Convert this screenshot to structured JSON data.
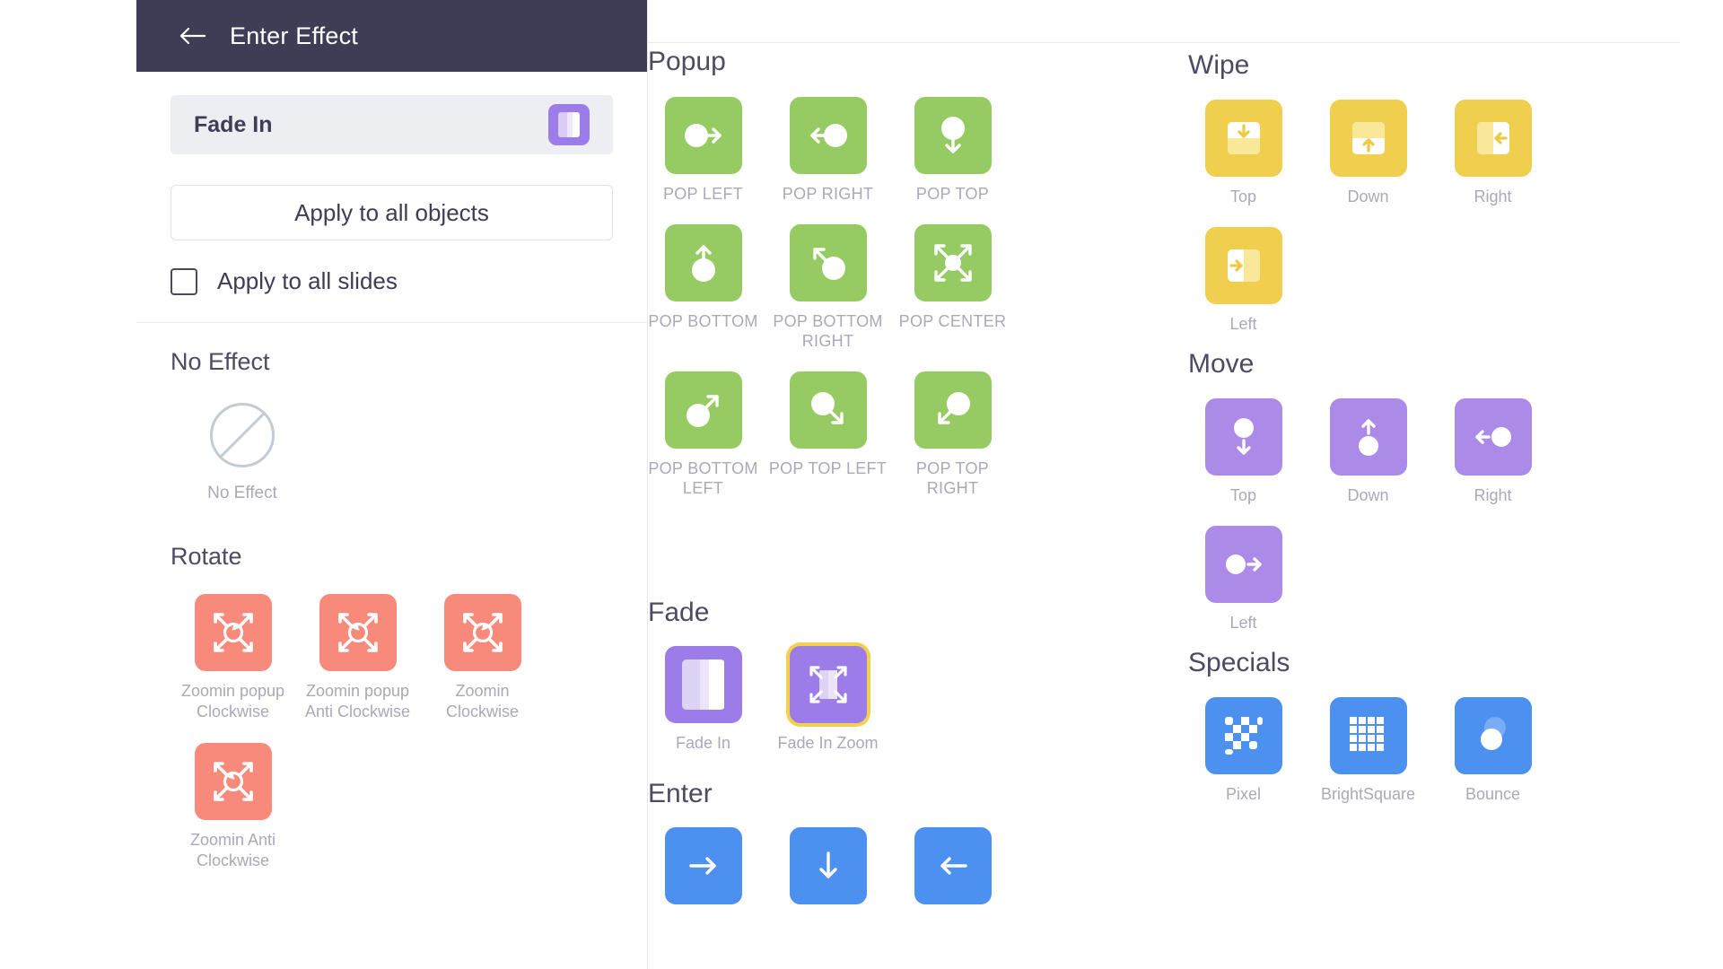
{
  "panel": {
    "back_icon": "back-arrow-icon",
    "title": "Enter Effect",
    "current_effect": "Fade In",
    "current_effect_icon": "fade-in-icon",
    "apply_to_all_objects": "Apply to all objects",
    "apply_to_all_slides": "Apply to all slides",
    "apply_to_all_slides_checked": false,
    "no_effect_section": "No Effect",
    "no_effect_label": "No Effect",
    "no_effect_icon": "no-effect-icon",
    "rotate_section": "Rotate",
    "rotate_items": [
      {
        "label": "Zoomin popup Clockwise",
        "icon": "zoom-rotate-cw-icon"
      },
      {
        "label": "Zoomin popup Anti Clockwise",
        "icon": "zoom-rotate-ccw-icon"
      },
      {
        "label": "Zoomin Clockwise",
        "icon": "zoom-rotate-cw-icon"
      },
      {
        "label": "Zoomin Anti Clockwise",
        "icon": "zoom-rotate-ccw-icon"
      }
    ]
  },
  "popup": {
    "title": "Popup",
    "items": [
      {
        "label": "POP LEFT",
        "icon": "circle-arrow-right-icon"
      },
      {
        "label": "POP RIGHT",
        "icon": "circle-arrow-left-icon"
      },
      {
        "label": "POP TOP",
        "icon": "circle-arrow-down-icon"
      },
      {
        "label": "POP BOTTOM",
        "icon": "circle-arrow-up-icon"
      },
      {
        "label": "POP BOTTOM RIGHT",
        "icon": "circle-arrow-up-left-icon"
      },
      {
        "label": "POP CENTER",
        "icon": "expand-center-icon"
      },
      {
        "label": "POP BOTTOM LEFT",
        "icon": "circle-arrow-up-right-icon"
      },
      {
        "label": "POP TOP LEFT",
        "icon": "circle-arrow-down-right-icon"
      },
      {
        "label": "POP TOP RIGHT",
        "icon": "circle-arrow-down-left-icon"
      }
    ]
  },
  "fade": {
    "title": "Fade",
    "items": [
      {
        "label": "Fade In",
        "icon": "fade-in-icon",
        "selected": false
      },
      {
        "label": "Fade In Zoom",
        "icon": "fade-in-zoom-icon",
        "selected": true
      }
    ]
  },
  "enter": {
    "title": "Enter",
    "items": [
      {
        "label": "",
        "icon": "arrow-right-icon"
      },
      {
        "label": "",
        "icon": "arrow-down-icon"
      },
      {
        "label": "",
        "icon": "arrow-left-icon"
      }
    ]
  },
  "wipe": {
    "title": "Wipe",
    "items": [
      {
        "label": "Top",
        "icon": "wipe-down-icon"
      },
      {
        "label": "Down",
        "icon": "wipe-up-icon"
      },
      {
        "label": "Right",
        "icon": "wipe-left-icon"
      },
      {
        "label": "Left",
        "icon": "wipe-right-icon"
      }
    ]
  },
  "move": {
    "title": "Move",
    "items": [
      {
        "label": "Top",
        "icon": "move-down-icon"
      },
      {
        "label": "Down",
        "icon": "move-up-icon"
      },
      {
        "label": "Right",
        "icon": "move-left-icon"
      },
      {
        "label": "Left",
        "icon": "move-right-icon"
      }
    ]
  },
  "specials": {
    "title": "Specials",
    "items": [
      {
        "label": "Pixel",
        "icon": "pixel-checker-icon"
      },
      {
        "label": "BrightSquare",
        "icon": "grid-squares-icon"
      },
      {
        "label": "Bounce",
        "icon": "bounce-ball-icon"
      }
    ]
  },
  "colors": {
    "header_bg": "#3f3d56",
    "rotate": "#f88a7c",
    "popup": "#96cb63",
    "wipe": "#f0ce4e",
    "move": "#ac8ae8",
    "fade": "#9b7ce8",
    "enter": "#4c90f0",
    "special": "#4c90f0",
    "selection": "#f5cf4e"
  }
}
